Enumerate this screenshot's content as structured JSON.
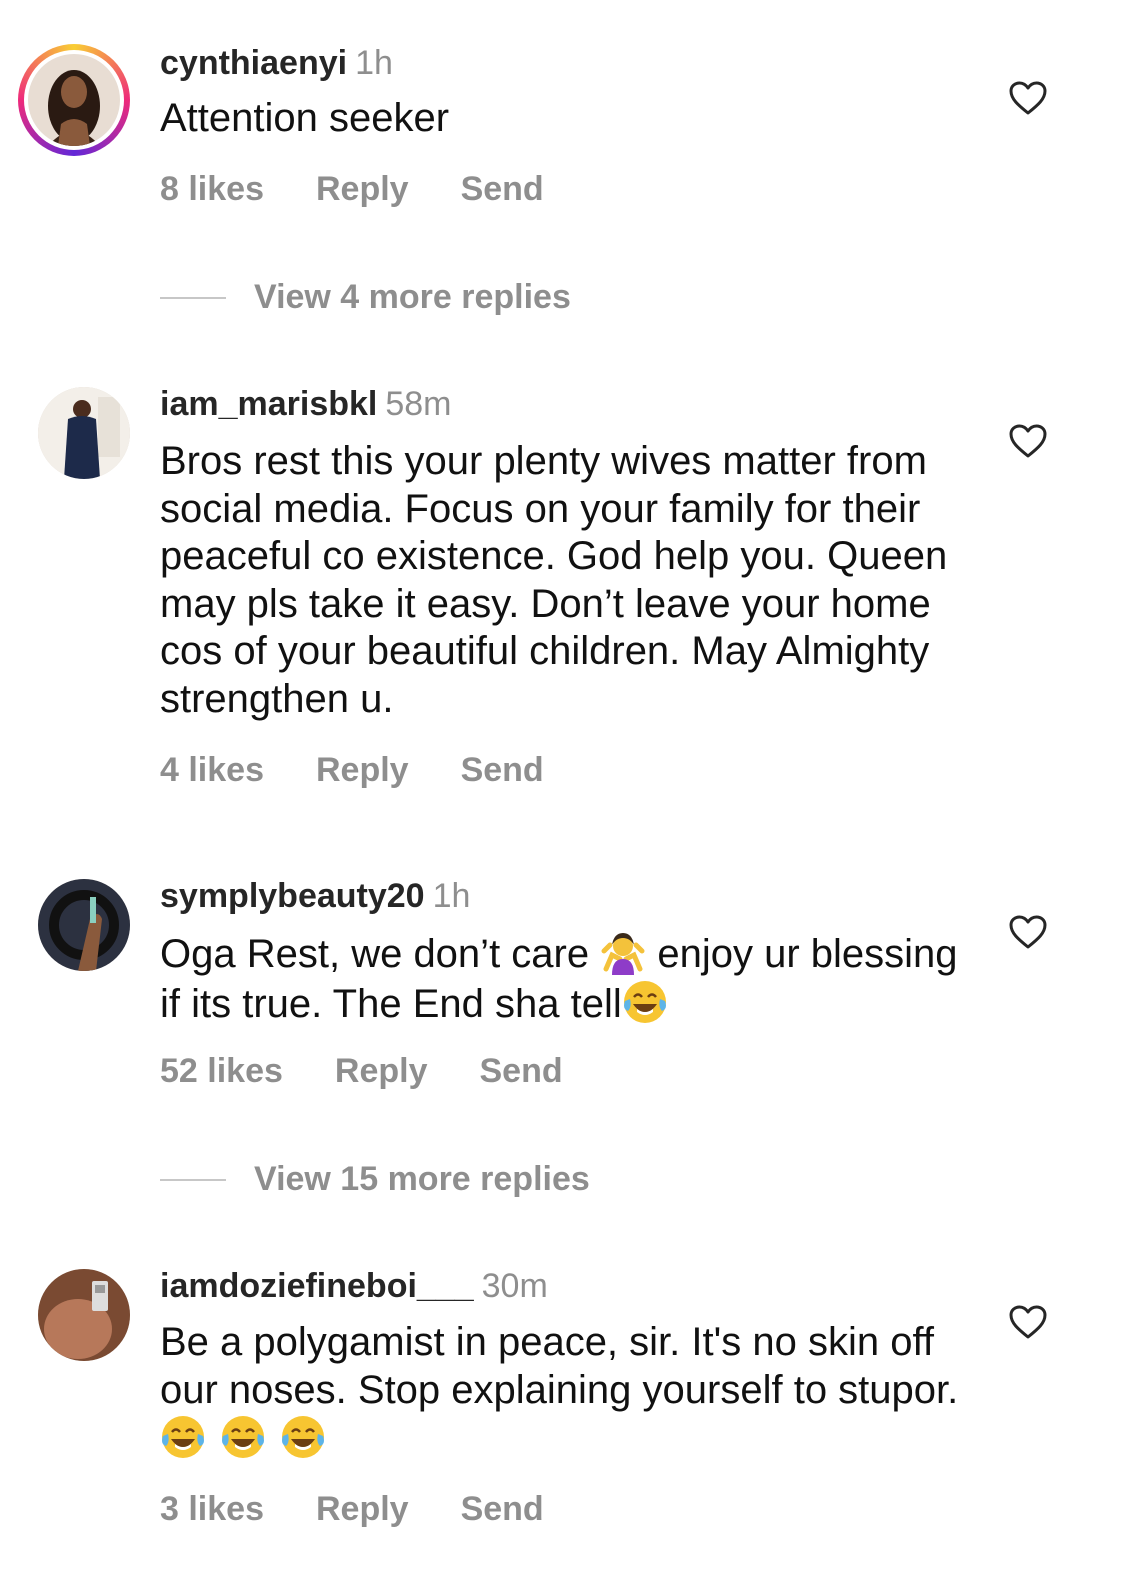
{
  "comments": [
    {
      "username": "cynthiaenyi",
      "time": "1h",
      "text": "Attention seeker",
      "likes": "8 likes",
      "reply_label": "Reply",
      "send_label": "Send",
      "has_story_ring": true
    },
    {
      "username": "iam_marisbkl",
      "time": "58m",
      "text": "Bros rest this your plenty wives matter from social media. Focus on your family for their peaceful co existence. God help you. Queen may pls take it easy. Don’t leave your home cos of your beautiful children. May Almighty strengthen u.",
      "likes": "4 likes",
      "reply_label": "Reply",
      "send_label": "Send"
    },
    {
      "username": "symplybeauty20",
      "time": "1h",
      "text_part1": "Oga Rest, we don’t care ",
      "text_part2": " enjoy ur blessing if its true. The End sha tell",
      "likes": "52 likes",
      "reply_label": "Reply",
      "send_label": "Send"
    },
    {
      "username": "iamdoziefineboi___",
      "time": "30m",
      "text": "Be a polygamist in peace, sir. It's no skin off our noses. Stop explaining yourself to stupor. ",
      "likes": "3 likes",
      "reply_label": "Reply",
      "send_label": "Send"
    }
  ],
  "view_replies": [
    "View 4 more replies",
    "View 15 more replies"
  ],
  "icons": {
    "like": "heart-outline-icon",
    "shrug": "person-shrugging-emoji",
    "laugh": "face-with-tears-of-joy-emoji"
  },
  "colors": {
    "secondary_text": "#8e8e8e",
    "primary_text": "#262626"
  }
}
